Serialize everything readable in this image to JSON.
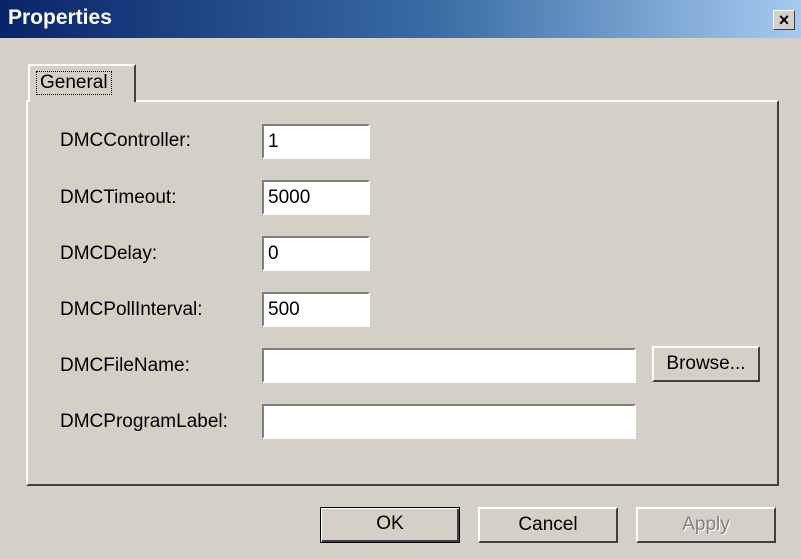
{
  "window": {
    "title": "Properties",
    "close_label": "×"
  },
  "tabs": [
    {
      "label": "General"
    }
  ],
  "fields": {
    "controller": {
      "label": "DMCController:",
      "value": "1"
    },
    "timeout": {
      "label": "DMCTimeout:",
      "value": "5000"
    },
    "delay": {
      "label": "DMCDelay:",
      "value": "0"
    },
    "poll_interval": {
      "label": "DMCPollInterval:",
      "value": "500"
    },
    "file_name": {
      "label": "DMCFileName:",
      "value": ""
    },
    "program_label": {
      "label": "DMCProgramLabel:",
      "value": ""
    }
  },
  "buttons": {
    "browse": "Browse...",
    "ok": "OK",
    "cancel": "Cancel",
    "apply": "Apply"
  }
}
